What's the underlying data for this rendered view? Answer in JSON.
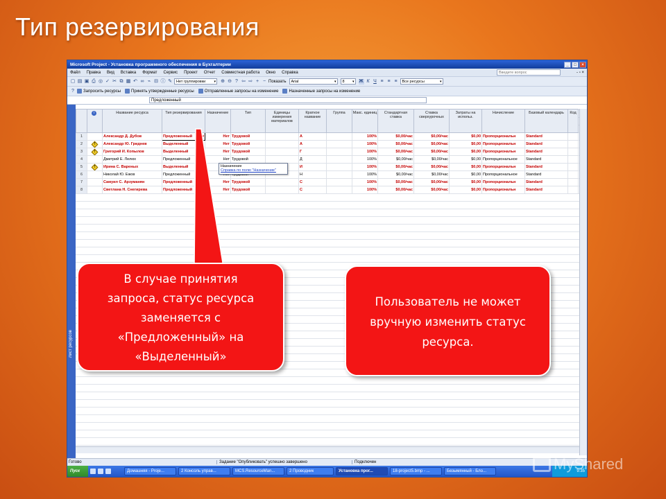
{
  "slide_title": "Тип резервирования",
  "window": {
    "title": "Microsoft Project - Установка программного обеспечения в Бухгалтерии",
    "menu": [
      "Файл",
      "Правка",
      "Вид",
      "Вставка",
      "Формат",
      "Сервис",
      "Проект",
      "Отчет",
      "Совместная работа",
      "Окно",
      "Справка"
    ],
    "ask_placeholder": "Введите вопрос"
  },
  "toolbar": {
    "group_combo": "Нет группировки",
    "show_label": "Показать",
    "font_combo": "Arial",
    "size_combo": "8",
    "filter_combo": "Все ресурсы",
    "bold": "Ж",
    "italic": "К",
    "underline": "Ч"
  },
  "toolbar2": {
    "request_resources": "Запросить ресурсы",
    "accept_proposed": "Принять утвержденные ресурсы",
    "sent_requests": "Отправленные запросы на изменение",
    "assigned_requests": "Назначенные запросы на изменение"
  },
  "edit_value": "Предложенный",
  "side_label": "Лист ресурсов",
  "columns": [
    "",
    "",
    "Название ресурса",
    "Тип резервирования",
    "Назначение",
    "Тип",
    "Единицы измерения материалов",
    "Краткое название",
    "Группа",
    "Макс. единиц",
    "Стандартная ставка",
    "Ставка сверхурочных",
    "Затраты на использ.",
    "Начисление",
    "Базовый календарь",
    "Код"
  ],
  "rows": [
    {
      "n": "1",
      "icon": "",
      "name": "Александр Д. Дубов",
      "res": "Предложенный",
      "assign": "Нет",
      "type": "Трудовой",
      "unit": "",
      "short": "А",
      "group": "",
      "max": "100%",
      "std": "$0,00/час",
      "ovt": "$0,00/час",
      "cost": "$0,00",
      "accr": "Пропорциональн",
      "cal": "Standard",
      "red": true
    },
    {
      "n": "2",
      "icon": "!",
      "name": "Александр Ю. Гриднев",
      "res": "Выделенный",
      "assign": "Нет",
      "type": "Трудовой",
      "unit": "",
      "short": "А",
      "group": "",
      "max": "100%",
      "std": "$0,00/час",
      "ovt": "$0,00/час",
      "cost": "$0,00",
      "accr": "Пропорциональн",
      "cal": "Standard",
      "red": true
    },
    {
      "n": "3",
      "icon": "!",
      "name": "Григорий И. Копылов",
      "res": "Выделенный",
      "assign": "Нет",
      "type": "Трудовой",
      "unit": "",
      "short": "Г",
      "group": "",
      "max": "100%",
      "std": "$0,00/час",
      "ovt": "$0,00/час",
      "cost": "$0,00",
      "accr": "Пропорциональн",
      "cal": "Standard",
      "red": true
    },
    {
      "n": "4",
      "icon": "",
      "name": "Дмитрий Е. Лелюх",
      "res": "Предложенный",
      "assign": "Нет",
      "type": "Трудовой",
      "unit": "",
      "short": "Д",
      "group": "",
      "max": "100%",
      "std": "$0,00/час",
      "ovt": "$0,00/час",
      "cost": "$0,00",
      "accr": "Пропорциональное",
      "cal": "Standard",
      "red": false
    },
    {
      "n": "5",
      "icon": "!",
      "name": "Ирина С. Вареных",
      "res": "Выделенный",
      "assign": "Нет",
      "type": "Трудовой",
      "unit": "",
      "short": "И",
      "group": "",
      "max": "100%",
      "std": "$0,00/час",
      "ovt": "$0,00/час",
      "cost": "$0,00",
      "accr": "Пропорциональн",
      "cal": "Standard",
      "red": true
    },
    {
      "n": "6",
      "icon": "",
      "name": "Николай Ю. Ежов",
      "res": "Предложенный",
      "assign": "Нет",
      "type": "Трудовой",
      "unit": "",
      "short": "Н",
      "group": "",
      "max": "100%",
      "std": "$0,00/час",
      "ovt": "$0,00/час",
      "cost": "$0,00",
      "accr": "Пропорциональное",
      "cal": "Standard",
      "red": false
    },
    {
      "n": "7",
      "icon": "",
      "name": "Самуил С. Арзуманян",
      "res": "Предложенный",
      "assign": "Нет",
      "type": "Трудовой",
      "unit": "",
      "short": "С",
      "group": "",
      "max": "100%",
      "std": "$0,00/час",
      "ovt": "$0,00/час",
      "cost": "$0,00",
      "accr": "Пропорциональн",
      "cal": "Standard",
      "red": true
    },
    {
      "n": "8",
      "icon": "",
      "name": "Светлана Н. Снегирева",
      "res": "Предложенный",
      "assign": "Нет",
      "type": "Трудовой",
      "unit": "",
      "short": "С",
      "group": "",
      "max": "100%",
      "std": "$0,00/час",
      "ovt": "$0,00/час",
      "cost": "$0,00",
      "accr": "Пропорциональн",
      "cal": "Standard",
      "red": true
    }
  ],
  "dropdown": {
    "title": "Назначение",
    "link": "Справка по полю \"Назначение\""
  },
  "status": {
    "ready": "Готово",
    "message": "Задание \"Опубликовать\" успешно завершено",
    "connection": "Подключен"
  },
  "taskbar": {
    "start": "Пуск",
    "tasks": [
      "Домашняя - Proje...",
      "2 Консоль управ...",
      "MCS.ResourceMan...",
      "2 Проводник",
      "Установка прог...",
      "18-project5.bmp - ...",
      "Безымянный - Бло..."
    ],
    "active_index": 4,
    "clock": "9:35"
  },
  "callouts": {
    "left": [
      "В случае принятия",
      "запроса, статус ресурса",
      "заменяется с",
      "«Предложенный» на",
      "«Выделенный»"
    ],
    "right": [
      "Пользователь не может",
      "вручную изменить статус",
      "ресурса."
    ]
  },
  "watermark": "MyShared",
  "colors": {
    "callout": "#f31515",
    "red_text": "#c40000",
    "titlebar": "#2b63d8"
  }
}
